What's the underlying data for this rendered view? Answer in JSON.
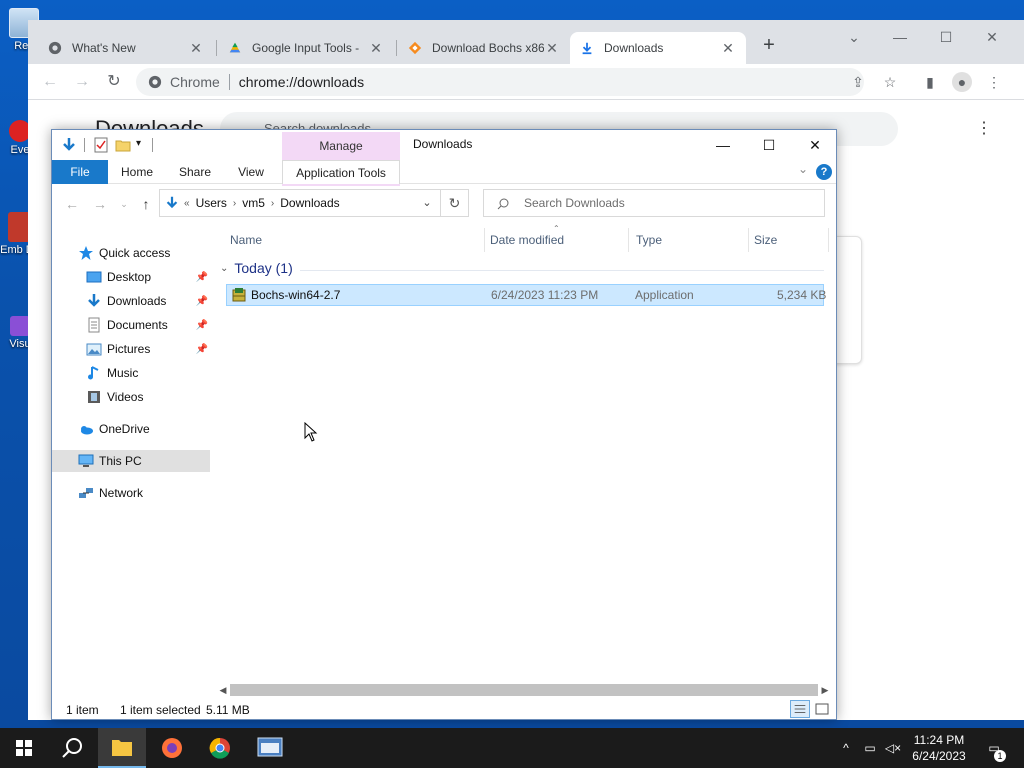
{
  "desktop": {
    "icons": [
      {
        "label": "Rec"
      },
      {
        "label": "Eve"
      },
      {
        "label": "Emb De"
      },
      {
        "label": "Visu"
      }
    ]
  },
  "chrome": {
    "tabs": [
      {
        "title": "What's New"
      },
      {
        "title": "Google Input Tools -"
      },
      {
        "title": "Download Bochs x86"
      },
      {
        "title": "Downloads"
      }
    ],
    "new_tab_label": "+",
    "omnibox_label": "Chrome",
    "omnibox_url": "chrome://downloads",
    "page_title": "Downloads",
    "page_search_placeholder": "Search downloads"
  },
  "explorer": {
    "title": "Downloads",
    "manage_label": "Manage",
    "ribbon_tabs": {
      "file": "File",
      "home": "Home",
      "share": "Share",
      "view": "View",
      "app_tools": "Application Tools"
    },
    "help": "?",
    "breadcrumb": {
      "overflow": "«",
      "items": [
        "Users",
        "vm5",
        "Downloads"
      ]
    },
    "search_placeholder": "Search Downloads",
    "nav": {
      "quick_access": "Quick access",
      "desktop": "Desktop",
      "downloads": "Downloads",
      "documents": "Documents",
      "pictures": "Pictures",
      "music": "Music",
      "videos": "Videos",
      "onedrive": "OneDrive",
      "this_pc": "This PC",
      "network": "Network"
    },
    "columns": {
      "name": "Name",
      "date": "Date modified",
      "type": "Type",
      "size": "Size"
    },
    "group_label": "Today (1)",
    "files": [
      {
        "name": "Bochs-win64-2.7",
        "date": "6/24/2023 11:23 PM",
        "type": "Application",
        "size": "5,234 KB"
      }
    ],
    "status": {
      "count": "1 item",
      "selected": "1 item selected",
      "size": "5.11 MB"
    }
  },
  "taskbar": {
    "clock_time": "11:24 PM",
    "clock_date": "6/24/2023",
    "notification_count": "1"
  },
  "colors": {
    "desktop_bg": "#0b5fc5",
    "selection": "#cce8ff",
    "accent": "#1979ca",
    "manage_band": "#f3d9f6"
  }
}
